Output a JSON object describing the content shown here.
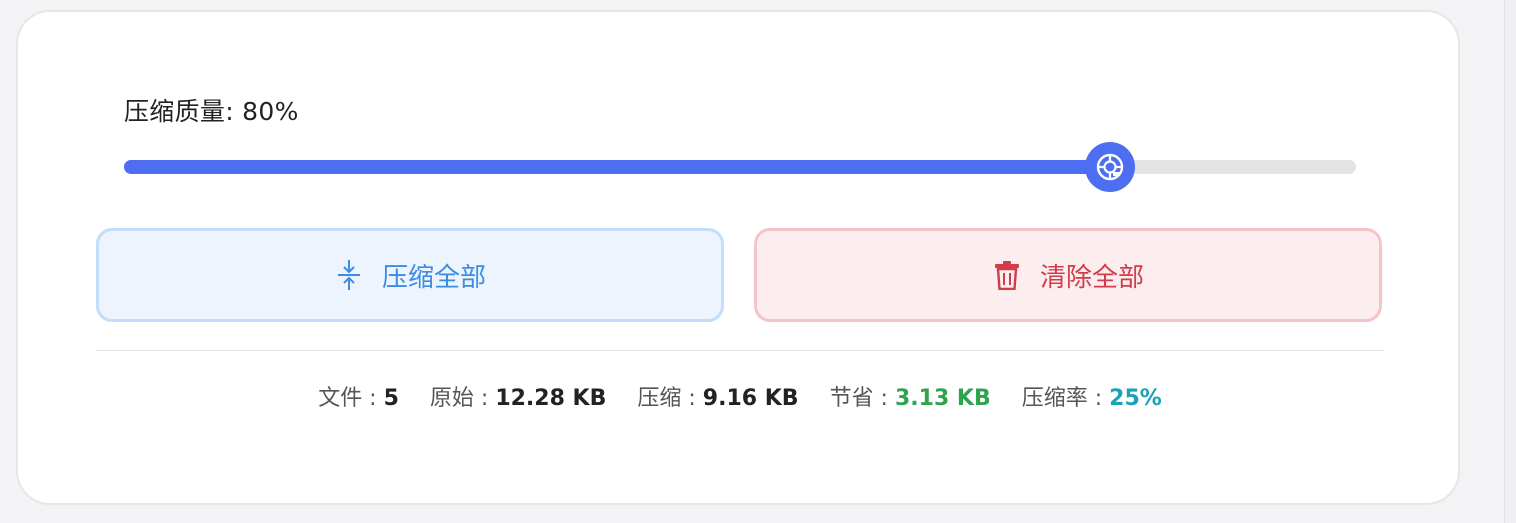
{
  "quality": {
    "label": "压缩质量: 80%",
    "value_percent": 80,
    "thumb_icon": "lifebuoy-icon"
  },
  "buttons": {
    "compress_all": {
      "label": "压缩全部",
      "icon": "compress-arrows-icon",
      "color": "#3a8ce6"
    },
    "clear_all": {
      "label": "清除全部",
      "icon": "trash-icon",
      "color": "#d23c4a"
    }
  },
  "stats": {
    "files": {
      "label": "文件 : ",
      "value": "5"
    },
    "original": {
      "label": "原始 : ",
      "value": "12.28 KB"
    },
    "compressed": {
      "label": "压缩 : ",
      "value": "9.16 KB"
    },
    "saved": {
      "label": "节省 : ",
      "value": "3.13 KB",
      "color": "#2ea44f"
    },
    "ratio": {
      "label": "压缩率 : ",
      "value": "25%",
      "color": "#1aa3b8"
    }
  },
  "colors": {
    "accent": "#4d6ef1"
  }
}
